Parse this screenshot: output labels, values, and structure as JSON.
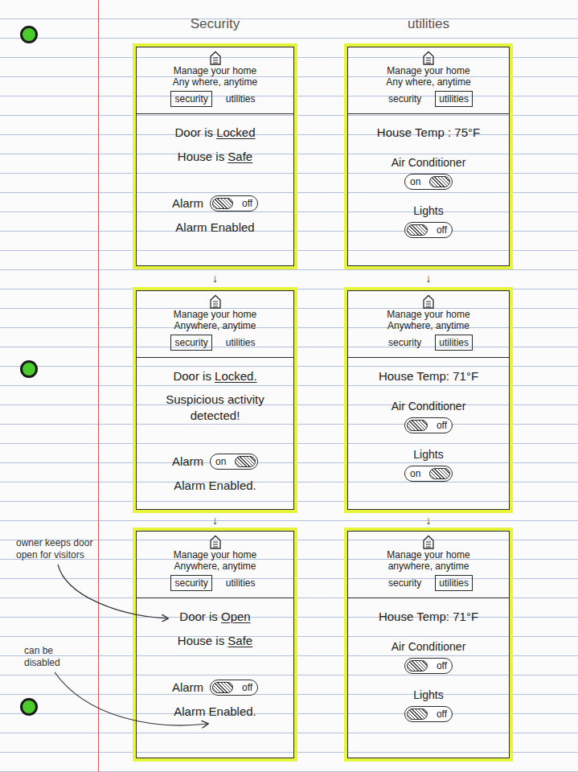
{
  "columns": [
    {
      "heading": "Security",
      "arrows": [
        "↓",
        "↓"
      ],
      "screens": [
        {
          "tagline": [
            "Manage your home",
            "Any where, anytime"
          ],
          "tabs": [
            {
              "label": "security",
              "selected": true
            },
            {
              "label": "utilities",
              "selected": false
            }
          ],
          "rows": [
            {
              "kind": "status",
              "label": "Door is",
              "value": "Locked"
            },
            {
              "kind": "status",
              "label": "House is",
              "value": "Safe"
            },
            {
              "kind": "switch",
              "label": "Alarm",
              "on": false,
              "state_text": "off"
            },
            {
              "kind": "note",
              "text": "Alarm Enabled"
            }
          ]
        },
        {
          "tagline": [
            "Manage your home",
            "Anywhere, anytime"
          ],
          "tabs": [
            {
              "label": "security",
              "selected": true
            },
            {
              "label": "utilities",
              "selected": false
            }
          ],
          "rows": [
            {
              "kind": "status",
              "label": "Door is",
              "value": "Locked."
            },
            {
              "kind": "alert",
              "text": "Suspicious activity detected!"
            },
            {
              "kind": "switch",
              "label": "Alarm",
              "on": true,
              "state_text": "on"
            },
            {
              "kind": "note",
              "text": "Alarm Enabled."
            }
          ]
        },
        {
          "tagline": [
            "Manage your home",
            "Anywhere, anytime"
          ],
          "tabs": [
            {
              "label": "security",
              "selected": true
            },
            {
              "label": "utilities",
              "selected": false
            }
          ],
          "rows": [
            {
              "kind": "status",
              "label": "Door is",
              "value": "Open"
            },
            {
              "kind": "status",
              "label": "House is",
              "value": "Safe"
            },
            {
              "kind": "switch",
              "label": "Alarm",
              "on": false,
              "state_text": "off"
            },
            {
              "kind": "note",
              "text": "Alarm Enabled."
            }
          ]
        }
      ]
    },
    {
      "heading": "utilities",
      "arrows": [
        "↓",
        "↓"
      ],
      "screens": [
        {
          "tagline": [
            "Manage your home",
            "Any where, anytime"
          ],
          "tabs": [
            {
              "label": "security",
              "selected": false
            },
            {
              "label": "utilities",
              "selected": true
            }
          ],
          "rows": [
            {
              "kind": "reading",
              "label": "House Temp :",
              "value": "75°F"
            },
            {
              "kind": "switch-stacked",
              "label": "Air Conditioner",
              "on": true,
              "state_text": "on"
            },
            {
              "kind": "switch-stacked",
              "label": "Lights",
              "on": false,
              "state_text": "off"
            }
          ]
        },
        {
          "tagline": [
            "Manage your home",
            "Anywhere, anytime"
          ],
          "tabs": [
            {
              "label": "security",
              "selected": false
            },
            {
              "label": "utilities",
              "selected": true
            }
          ],
          "rows": [
            {
              "kind": "reading",
              "label": "House Temp:",
              "value": "71°F"
            },
            {
              "kind": "switch-stacked",
              "label": "Air Conditioner",
              "on": false,
              "state_text": "off"
            },
            {
              "kind": "switch-stacked",
              "label": "Lights",
              "on": true,
              "state_text": "on"
            }
          ]
        },
        {
          "tagline": [
            "Manage your home",
            "anywhere, anytime"
          ],
          "tabs": [
            {
              "label": "security",
              "selected": false
            },
            {
              "label": "utilities",
              "selected": true
            }
          ],
          "rows": [
            {
              "kind": "reading",
              "label": "House Temp:",
              "value": "71°F"
            },
            {
              "kind": "switch-stacked",
              "label": "Air Conditioner",
              "on": false,
              "state_text": "off"
            },
            {
              "kind": "switch-stacked",
              "label": "Lights",
              "on": false,
              "state_text": "off"
            }
          ]
        }
      ]
    }
  ],
  "annotations": [
    {
      "text": "owner keeps door open for visitors"
    },
    {
      "text": "can be disabled"
    }
  ]
}
